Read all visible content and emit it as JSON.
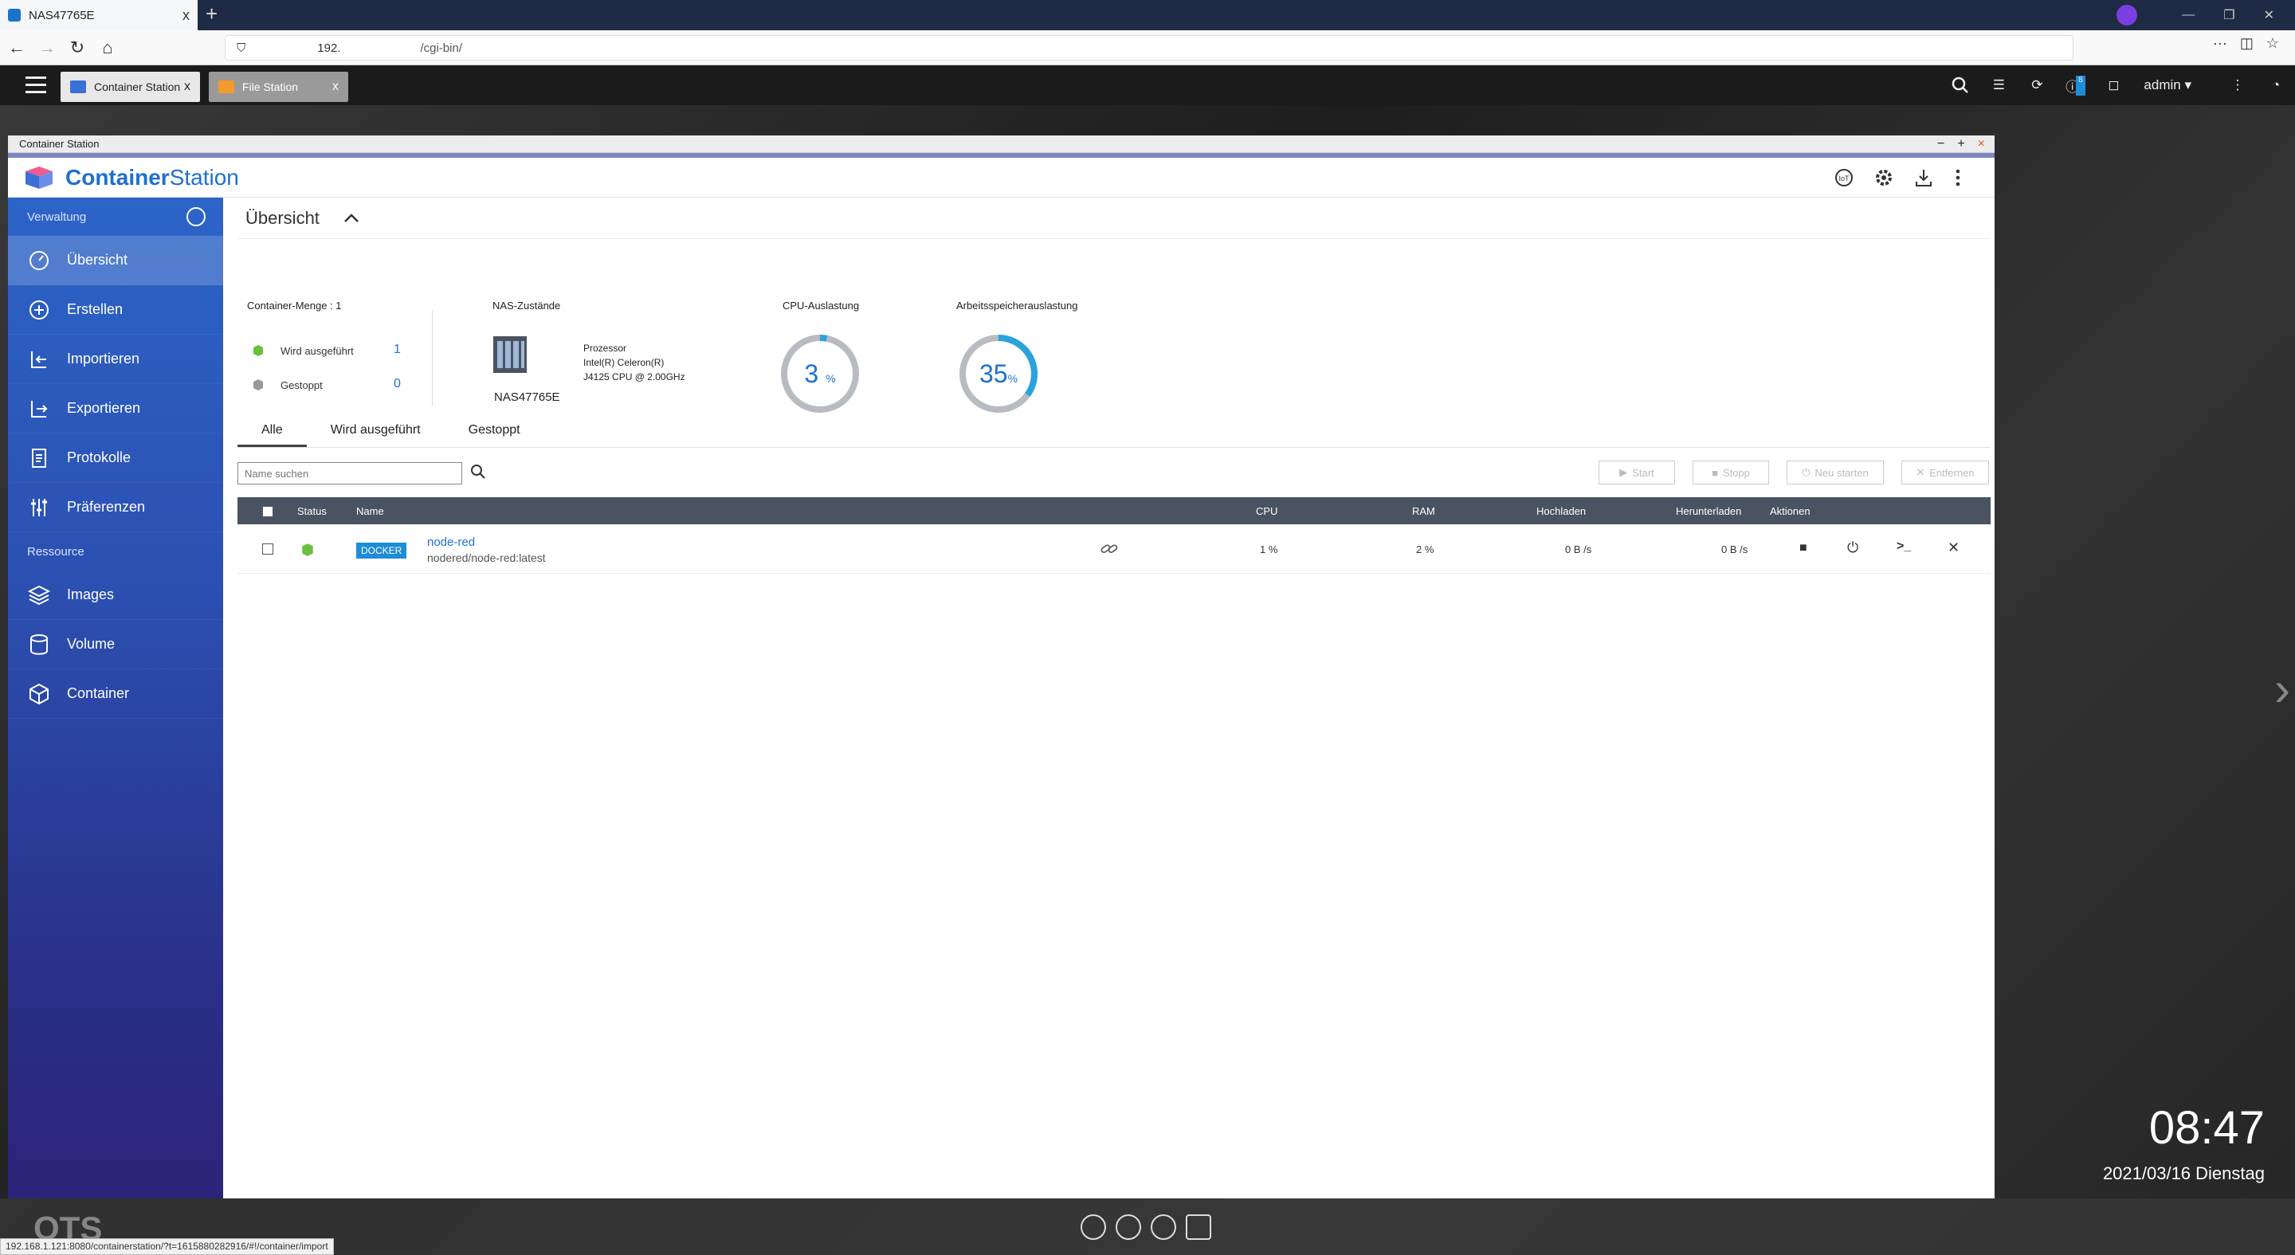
{
  "browser": {
    "tab_title": "NAS47765E",
    "tab_close": "x",
    "new_tab": "+",
    "url_part1": "192.",
    "url_part2": "/cgi-bin/",
    "url_menu": "···"
  },
  "qts": {
    "tabs": [
      {
        "label": "Container Station",
        "close": "x"
      },
      {
        "label": "File Station",
        "close": "x"
      }
    ],
    "user": "admin",
    "notification_badge": "8"
  },
  "window": {
    "title": "Container Station",
    "controls": {
      "min": "−",
      "max": "+",
      "close": "×"
    }
  },
  "app": {
    "name_bold": "Container",
    "name_light": "Station"
  },
  "sidebar": {
    "section_1": "Verwaltung",
    "section_2": "Ressource",
    "items": [
      {
        "label": "Übersicht",
        "icon": "dashboard-icon"
      },
      {
        "label": "Erstellen",
        "icon": "plus-circle-icon"
      },
      {
        "label": "Importieren",
        "icon": "import-icon"
      },
      {
        "label": "Exportieren",
        "icon": "export-icon"
      },
      {
        "label": "Protokolle",
        "icon": "document-icon"
      },
      {
        "label": "Präferenzen",
        "icon": "sliders-icon"
      }
    ],
    "resources": [
      {
        "label": "Images",
        "icon": "layers-icon"
      },
      {
        "label": "Volume",
        "icon": "database-icon"
      },
      {
        "label": "Container",
        "icon": "cube-icon"
      }
    ]
  },
  "overview": {
    "title": "Übersicht",
    "container_count_label": "Container-Menge : 1",
    "running_label": "Wird ausgeführt",
    "running_count": "1",
    "stopped_label": "Gestoppt",
    "stopped_count": "0",
    "nas_status_label": "NAS-Zustände",
    "processor_label": "Prozessor",
    "processor_line1": "Intel(R) Celeron(R)",
    "processor_line2": "J4125 CPU @ 2.00GHz",
    "nas_name": "NAS47765E",
    "cpu_label": "CPU-Auslastung",
    "cpu_value": "3",
    "cpu_fraction": 0.03,
    "mem_label": "Arbeitsspeicherauslastung",
    "mem_value": "35",
    "mem_fraction": 0.35,
    "percent": "%"
  },
  "filter_tabs": [
    "Alle",
    "Wird ausgeführt",
    "Gestoppt"
  ],
  "search": {
    "placeholder": "Name suchen"
  },
  "actions": {
    "start": "Start",
    "stop": "Stopp",
    "restart": "Neu starten",
    "remove": "Entfernen"
  },
  "table": {
    "headers": {
      "status": "Status",
      "name": "Name",
      "cpu": "CPU",
      "ram": "RAM",
      "upload": "Hochladen",
      "download": "Herunterladen",
      "actions": "Aktionen"
    },
    "rows": [
      {
        "type": "DOCKER",
        "name": "node-red",
        "image": "nodered/node-red:latest",
        "cpu": "1 %",
        "ram": "2 %",
        "upload": "0 B /s",
        "download": "0 B /s"
      }
    ]
  },
  "desktop": {
    "time": "08:47",
    "date": "2021/03/16 Dienstag",
    "logo": "QTS",
    "status_url": "192.168.1.121:8080/containerstation/?t=1615880282916/#!/container/import"
  },
  "colors": {
    "accent": "#1f6fd1",
    "sidebar_top": "#2d64c8",
    "sidebar_bottom": "#2c2479",
    "table_header": "#4a5361",
    "running_green": "#6bbf3f"
  }
}
